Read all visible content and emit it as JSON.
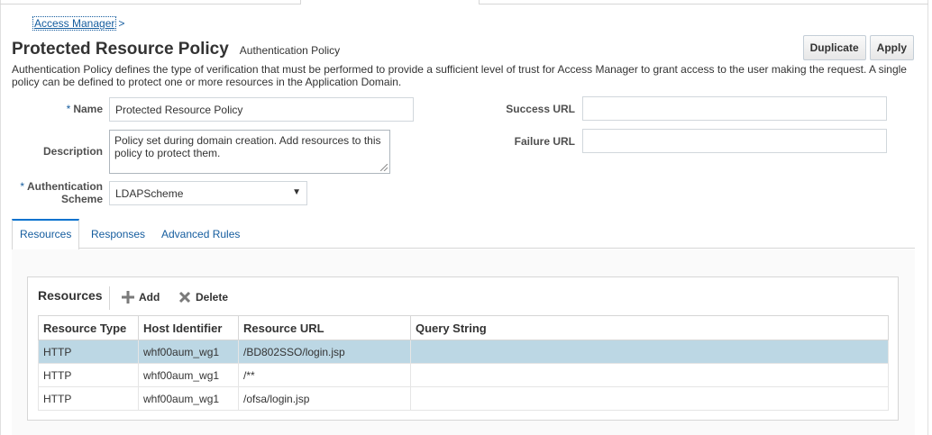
{
  "breadcrumb": {
    "link": "Access Manager",
    "separator": ">"
  },
  "page": {
    "title": "Protected Resource Policy",
    "subtitle": "Authentication Policy",
    "description": "Authentication Policy defines the type of verification that must be performed to provide a sufficient level of trust for Access Manager to grant access to the user making the request. A single policy can be defined to protect one or more resources in the Application Domain."
  },
  "toolbar": {
    "duplicate_label": "Duplicate",
    "apply_label": "Apply"
  },
  "form": {
    "required_marker": "*",
    "name_label": "Name",
    "name_value": "Protected Resource Policy",
    "description_label": "Description",
    "description_value": "Policy set during domain creation. Add resources to this policy to protect them.",
    "auth_scheme_label_line1": "Authentication",
    "auth_scheme_label_line2": "Scheme",
    "auth_scheme_value": "LDAPScheme",
    "success_url_label": "Success URL",
    "success_url_value": "",
    "failure_url_label": "Failure URL",
    "failure_url_value": ""
  },
  "tabs": [
    {
      "label": "Resources",
      "active": true
    },
    {
      "label": "Responses",
      "active": false
    },
    {
      "label": "Advanced Rules",
      "active": false
    }
  ],
  "resources": {
    "header": "Resources",
    "add_label": "Add",
    "delete_label": "Delete",
    "columns": [
      "Resource Type",
      "Host Identifier",
      "Resource URL",
      "Query String"
    ],
    "rows": [
      {
        "type": "HTTP",
        "host": "whf00aum_wg1",
        "url": "/BD802SSO/login.jsp",
        "query": "",
        "selected": true
      },
      {
        "type": "HTTP",
        "host": "whf00aum_wg1",
        "url": "/**",
        "query": "",
        "selected": false
      },
      {
        "type": "HTTP",
        "host": "whf00aum_wg1",
        "url": "/ofsa/login.jsp",
        "query": "",
        "selected": false
      }
    ]
  },
  "colors": {
    "link": "#145c9e",
    "selected_row": "#bcd7e4",
    "active_tab_border": "#0572ce"
  },
  "icons": {
    "add": "plus-icon",
    "delete": "x-icon",
    "dropdown": "chevron-down-icon"
  }
}
